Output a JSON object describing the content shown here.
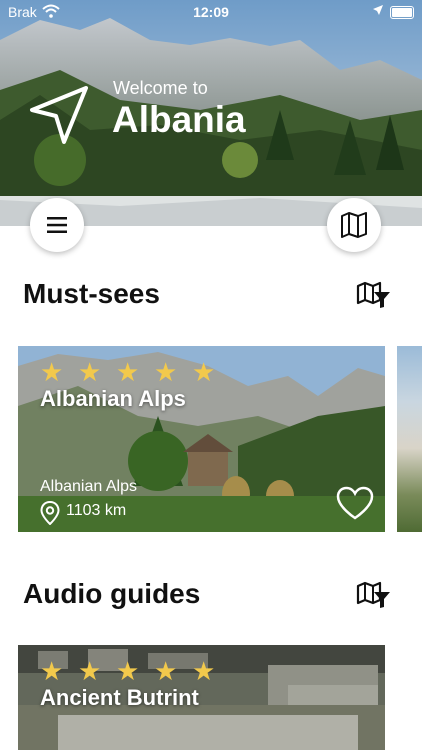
{
  "status_bar": {
    "carrier": "Brak",
    "time": "12:09"
  },
  "header": {
    "welcome": "Welcome to",
    "country": "Albania"
  },
  "icons": {
    "nav": "navigation-arrow-icon",
    "menu": "hamburger-menu-icon",
    "map": "map-icon",
    "filter": "map-filter-icon",
    "pin": "location-pin-icon",
    "heart": "heart-icon",
    "star": "star-icon"
  },
  "colors": {
    "star": "#f2c94c",
    "text": "#111111",
    "hero_text": "#ffffff"
  },
  "sections": {
    "must_sees": {
      "title": "Must-sees",
      "cards": [
        {
          "title": "Albanian Alps",
          "subtitle": "Albanian Alps",
          "distance": "1103 km",
          "rating": 5
        }
      ]
    },
    "audio_guides": {
      "title": "Audio guides",
      "cards": [
        {
          "title": "Ancient Butrint",
          "rating": 5
        }
      ]
    }
  }
}
